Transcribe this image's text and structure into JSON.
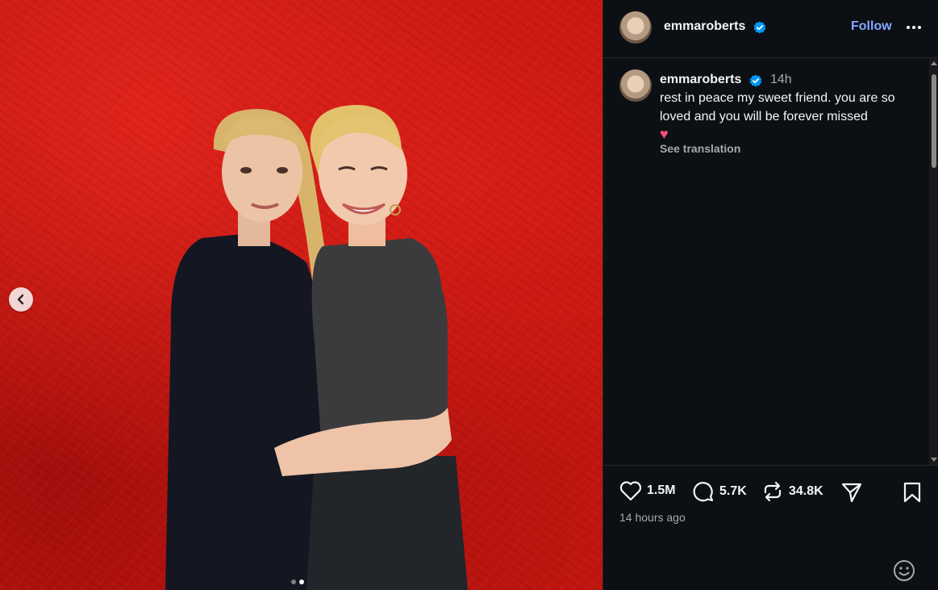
{
  "post": {
    "username": "emmaroberts",
    "follow_label": "Follow",
    "time_short": "14h",
    "caption": "rest in peace my sweet friend. you are so loved and you will be forever missed",
    "caption_emoji": "♥",
    "see_translation": "See translation",
    "time_long": "14 hours ago"
  },
  "stats": {
    "likes": "1.5M",
    "comments": "5.7K",
    "reposts": "34.8K"
  },
  "carousel": {
    "current": 2,
    "total": 2
  },
  "colors": {
    "panel_bg": "#0c1014",
    "accent_link": "#84a7ff",
    "verified": "#0095f6",
    "backdrop_red": "#c4170f"
  },
  "icons": [
    "chevron-left-icon",
    "verified-icon",
    "more-icon",
    "heart-icon",
    "comment-icon",
    "repost-icon",
    "share-icon",
    "bookmark-icon",
    "emoji-icon"
  ]
}
